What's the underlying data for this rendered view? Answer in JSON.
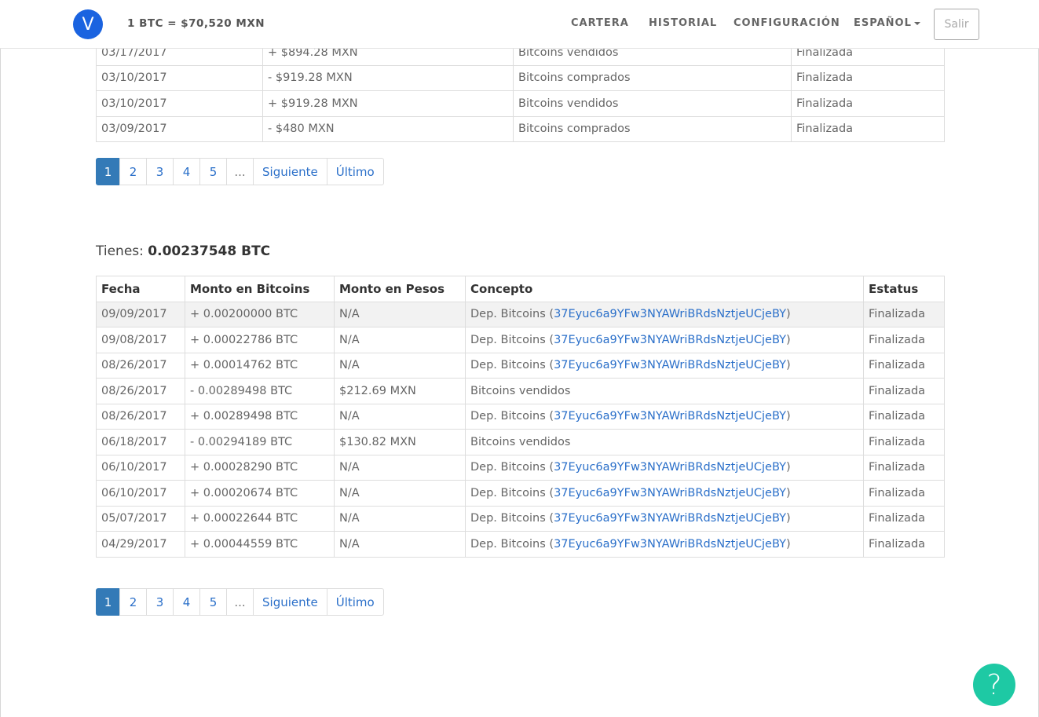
{
  "navbar": {
    "logo_letter": "V",
    "rate": "1 BTC = $70,520 MXN",
    "links": [
      "CARTERA",
      "HISTORIAL",
      "CONFIGURACIÓN",
      "ESPAÑOL"
    ],
    "logout": "Salir"
  },
  "top_table": {
    "rows": [
      [
        "03/17/2017",
        "+ $894.28 MXN",
        "Bitcoins vendidos",
        "Finalizada"
      ],
      [
        "03/10/2017",
        "- $919.28 MXN",
        "Bitcoins comprados",
        "Finalizada"
      ],
      [
        "03/10/2017",
        "+ $919.28 MXN",
        "Bitcoins vendidos",
        "Finalizada"
      ],
      [
        "03/09/2017",
        "- $480 MXN",
        "Bitcoins comprados",
        "Finalizada"
      ]
    ]
  },
  "pagination": {
    "pages": [
      "1",
      "2",
      "3",
      "4",
      "5",
      "..."
    ],
    "next": "Siguiente",
    "last": "Último"
  },
  "balance": {
    "label": "Tienes:",
    "amount": "0.00237548 BTC"
  },
  "btc_table": {
    "headers": [
      "Fecha",
      "Monto en Bitcoins",
      "Monto en Pesos",
      "Concepto",
      "Estatus"
    ],
    "rows": [
      {
        "fecha": "09/09/2017",
        "btc": "+ 0.00200000 BTC",
        "pesos": "N/A",
        "concepto": "Dep. Bitcoins (",
        "address": "37Eyuc6a9YFw3NYAWriBRdsNztjeUCjeBY",
        "close": ")",
        "estatus": "Finalizada"
      },
      {
        "fecha": "09/08/2017",
        "btc": "+ 0.00022786 BTC",
        "pesos": "N/A",
        "concepto": "Dep. Bitcoins (",
        "address": "37Eyuc6a9YFw3NYAWriBRdsNztjeUCjeBY",
        "close": ")",
        "estatus": "Finalizada"
      },
      {
        "fecha": "08/26/2017",
        "btc": "+ 0.00014762 BTC",
        "pesos": "N/A",
        "concepto": "Dep. Bitcoins (",
        "address": "37Eyuc6a9YFw3NYAWriBRdsNztjeUCjeBY",
        "close": ")",
        "estatus": "Finalizada"
      },
      {
        "fecha": "08/26/2017",
        "btc": "- 0.00289498 BTC",
        "pesos": "$212.69 MXN",
        "concepto": "Bitcoins vendidos",
        "address": "",
        "close": "",
        "estatus": "Finalizada"
      },
      {
        "fecha": "08/26/2017",
        "btc": "+ 0.00289498 BTC",
        "pesos": "N/A",
        "concepto": "Dep. Bitcoins (",
        "address": "37Eyuc6a9YFw3NYAWriBRdsNztjeUCjeBY",
        "close": ")",
        "estatus": "Finalizada"
      },
      {
        "fecha": "06/18/2017",
        "btc": "- 0.00294189 BTC",
        "pesos": "$130.82 MXN",
        "concepto": "Bitcoins vendidos",
        "address": "",
        "close": "",
        "estatus": "Finalizada"
      },
      {
        "fecha": "06/10/2017",
        "btc": "+ 0.00028290 BTC",
        "pesos": "N/A",
        "concepto": "Dep. Bitcoins (",
        "address": "37Eyuc6a9YFw3NYAWriBRdsNztjeUCjeBY",
        "close": ")",
        "estatus": "Finalizada"
      },
      {
        "fecha": "06/10/2017",
        "btc": "+ 0.00020674 BTC",
        "pesos": "N/A",
        "concepto": "Dep. Bitcoins (",
        "address": "37Eyuc6a9YFw3NYAWriBRdsNztjeUCjeBY",
        "close": ")",
        "estatus": "Finalizada"
      },
      {
        "fecha": "05/07/2017",
        "btc": "+ 0.00022644 BTC",
        "pesos": "N/A",
        "concepto": "Dep. Bitcoins (",
        "address": "37Eyuc6a9YFw3NYAWriBRdsNztjeUCjeBY",
        "close": ")",
        "estatus": "Finalizada"
      },
      {
        "fecha": "04/29/2017",
        "btc": "+ 0.00044559 BTC",
        "pesos": "N/A",
        "concepto": "Dep. Bitcoins (",
        "address": "37Eyuc6a9YFw3NYAWriBRdsNztjeUCjeBY",
        "close": ")",
        "estatus": "Finalizada"
      }
    ]
  },
  "help": {
    "glyph": "?"
  },
  "colors": {
    "link": "#2a6fc9",
    "active_page": "#337ab7",
    "help_button": "#1ec9a4",
    "logo": "#1a63e0"
  }
}
